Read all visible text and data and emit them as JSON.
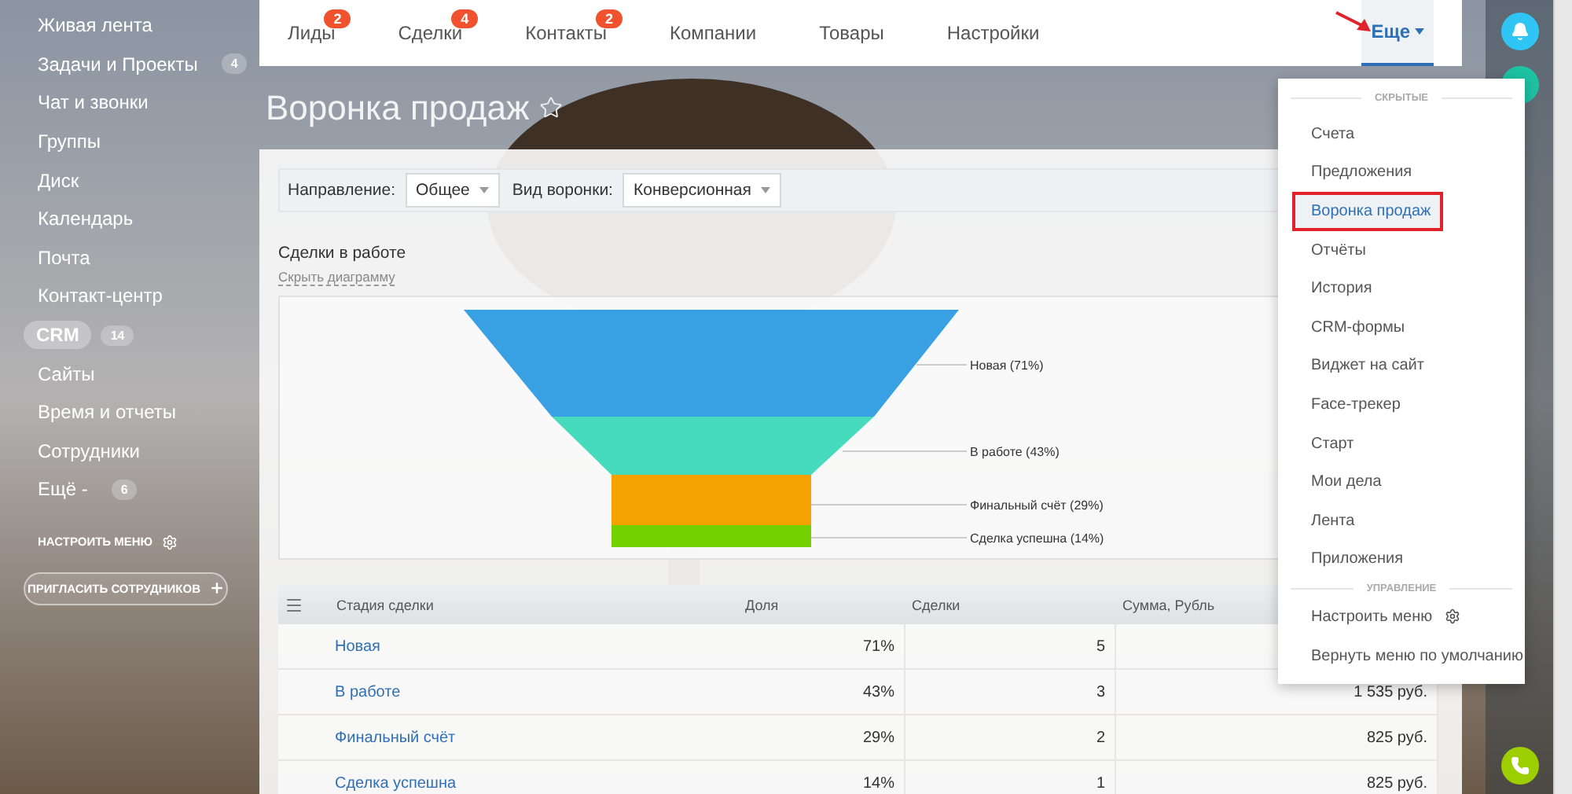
{
  "sidebar": {
    "items": [
      {
        "label": "Живая лента",
        "selected": false
      },
      {
        "label": "Задачи и Проекты",
        "badge": "4",
        "selected": false
      },
      {
        "label": "Чат и звонки",
        "selected": false
      },
      {
        "label": "Группы",
        "selected": false
      },
      {
        "label": "Диск",
        "selected": false
      },
      {
        "label": "Календарь",
        "selected": false
      },
      {
        "label": "Почта",
        "selected": false
      },
      {
        "label": "Контакт-центр",
        "selected": false
      },
      {
        "label": "CRM",
        "badge": "14",
        "selected": true
      },
      {
        "label": "Сайты",
        "selected": false
      },
      {
        "label": "Время и отчеты",
        "selected": false
      },
      {
        "label": "Сотрудники",
        "selected": false
      },
      {
        "label": "Ещё -",
        "badge": "6",
        "selected": false
      }
    ],
    "settings_link": "НАСТРОИТЬ МЕНЮ",
    "invite_button": "ПРИГЛАСИТЬ СОТРУДНИКОВ"
  },
  "tabs": [
    {
      "label": "Лиды",
      "badge": "2",
      "selected": false
    },
    {
      "label": "Сделки",
      "badge": "4",
      "selected": false
    },
    {
      "label": "Контакты",
      "badge": "2",
      "selected": false
    },
    {
      "label": "Компании",
      "selected": false
    },
    {
      "label": "Товары",
      "selected": false
    },
    {
      "label": "Настройки",
      "selected": false
    }
  ],
  "more_tab": {
    "label": "Еще",
    "selected": true
  },
  "page_title": "Воронка продаж",
  "filters": [
    {
      "label": "Направление:",
      "value": "Общее"
    },
    {
      "label": "Вид воронки:",
      "value": "Конверсионная"
    }
  ],
  "section_title": "Сделки в работе",
  "toggle_link": "Скрыть диаграмму",
  "funnel": {
    "segments": [
      {
        "label": "Новая (71%)",
        "color": "#3aa0e4"
      },
      {
        "label": "В работе (43%)",
        "color": "#47dbbe"
      },
      {
        "label": "Финальный счёт (29%)",
        "color": "#f5a200"
      },
      {
        "label": "Сделка успешна (14%)",
        "color": "#74d100"
      }
    ]
  },
  "table": {
    "columns": [
      "Стадия сделки",
      "Доля",
      "Сделки",
      "Сумма, Рубль"
    ],
    "rows": [
      {
        "stage": "Новая",
        "share": "71%",
        "deals": "5"
      },
      {
        "stage": "В работе",
        "share": "43%",
        "deals": "3",
        "sum": "1 535 руб."
      },
      {
        "stage": "Финальный счёт",
        "share": "29%",
        "deals": "2",
        "sum": "825 руб."
      },
      {
        "stage": "Сделка успешна",
        "share": "14%",
        "deals": "1",
        "sum": "825 руб."
      }
    ]
  },
  "menu": {
    "sections": [
      {
        "title": "СКРЫТЫЕ",
        "items": [
          {
            "label": "Счета",
            "selected": false
          },
          {
            "label": "Предложения",
            "selected": false
          },
          {
            "label": "Воронка продаж",
            "selected": true
          },
          {
            "label": "Отчёты",
            "selected": false
          },
          {
            "label": "История",
            "selected": false
          },
          {
            "label": "CRM-формы",
            "selected": false
          },
          {
            "label": "Виджет на сайт",
            "selected": false
          },
          {
            "label": "Face-трекер",
            "selected": false
          },
          {
            "label": "Старт",
            "selected": false
          },
          {
            "label": "Мои дела",
            "selected": false
          },
          {
            "label": "Лента",
            "selected": false
          },
          {
            "label": "Приложения",
            "selected": false
          }
        ]
      },
      {
        "title": "УПРАВЛЕНИЕ",
        "items": [
          {
            "label": "Настроить меню",
            "kind": "settings",
            "selected": false
          },
          {
            "label": "Вернуть меню по умолчанию",
            "selected": false
          }
        ]
      }
    ]
  }
}
